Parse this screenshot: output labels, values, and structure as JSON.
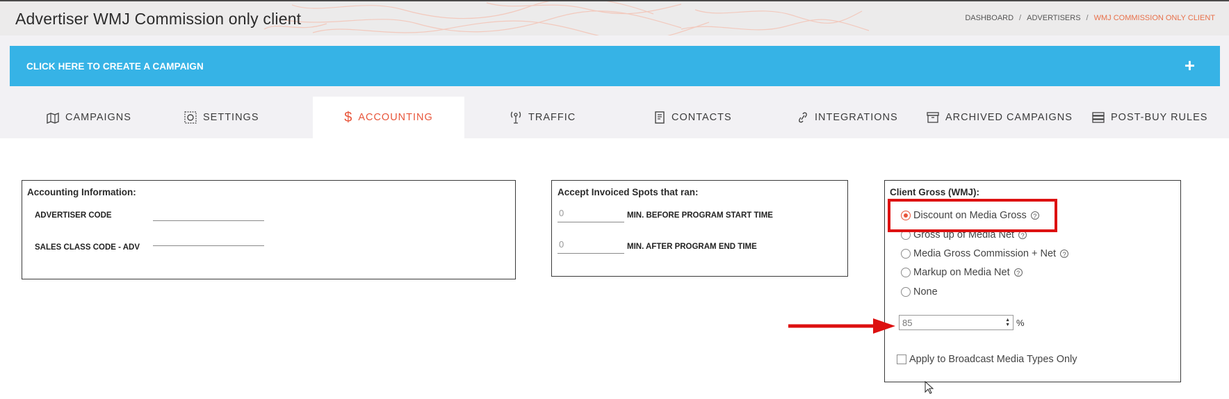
{
  "header": {
    "title": "Advertiser WMJ Commission only client",
    "breadcrumb": [
      "DASHBOARD",
      "ADVERTISERS",
      "WMJ COMMISSION ONLY CLIENT"
    ]
  },
  "create_bar": {
    "label": "CLICK HERE TO CREATE A CAMPAIGN",
    "plus": "+"
  },
  "tabs": [
    {
      "label": "CAMPAIGNS",
      "icon": "campaigns-map-icon",
      "active": false
    },
    {
      "label": "SETTINGS",
      "icon": "settings-gear-icon",
      "active": false
    },
    {
      "label": "ACCOUNTING",
      "icon": "dollar-icon",
      "active": true
    },
    {
      "label": "TRAFFIC",
      "icon": "antenna-icon",
      "active": false
    },
    {
      "label": "CONTACTS",
      "icon": "contacts-book-icon",
      "active": false
    },
    {
      "label": "INTEGRATIONS",
      "icon": "link-icon",
      "active": false
    },
    {
      "label": "ARCHIVED CAMPAIGNS",
      "icon": "archive-box-icon",
      "active": false
    },
    {
      "label": "POST-BUY RULES",
      "icon": "rules-list-icon",
      "active": false
    }
  ],
  "accounting_info": {
    "title": "Accounting Information:",
    "advertiser_code_label": "ADVERTISER CODE",
    "advertiser_code_value": "",
    "sales_class_label": "SALES CLASS CODE - ADV",
    "sales_class_value": ""
  },
  "invoiced_spots": {
    "title": "Accept Invoiced Spots that ran:",
    "min_before_value": "0",
    "min_before_label": "MIN. BEFORE PROGRAM START TIME",
    "min_after_value": "0",
    "min_after_label": "MIN. AFTER PROGRAM END TIME"
  },
  "client_gross": {
    "title": "Client Gross (WMJ):",
    "options": [
      {
        "label": "Discount on Media Gross",
        "checked": true,
        "help": true
      },
      {
        "label": "Gross up of Media Net",
        "checked": false,
        "help": true
      },
      {
        "label": "Media Gross Commission + Net",
        "checked": false,
        "help": true
      },
      {
        "label": "Markup on Media Net",
        "checked": false,
        "help": true
      },
      {
        "label": "None",
        "checked": false,
        "help": false
      }
    ],
    "percent_value": "85",
    "percent_symbol": "%",
    "broadcast_only_label": "Apply to Broadcast Media Types Only",
    "broadcast_only_checked": false
  },
  "colors": {
    "accent": "#e8553a",
    "create_bar": "#36b3e6",
    "highlight": "#dd1111"
  }
}
